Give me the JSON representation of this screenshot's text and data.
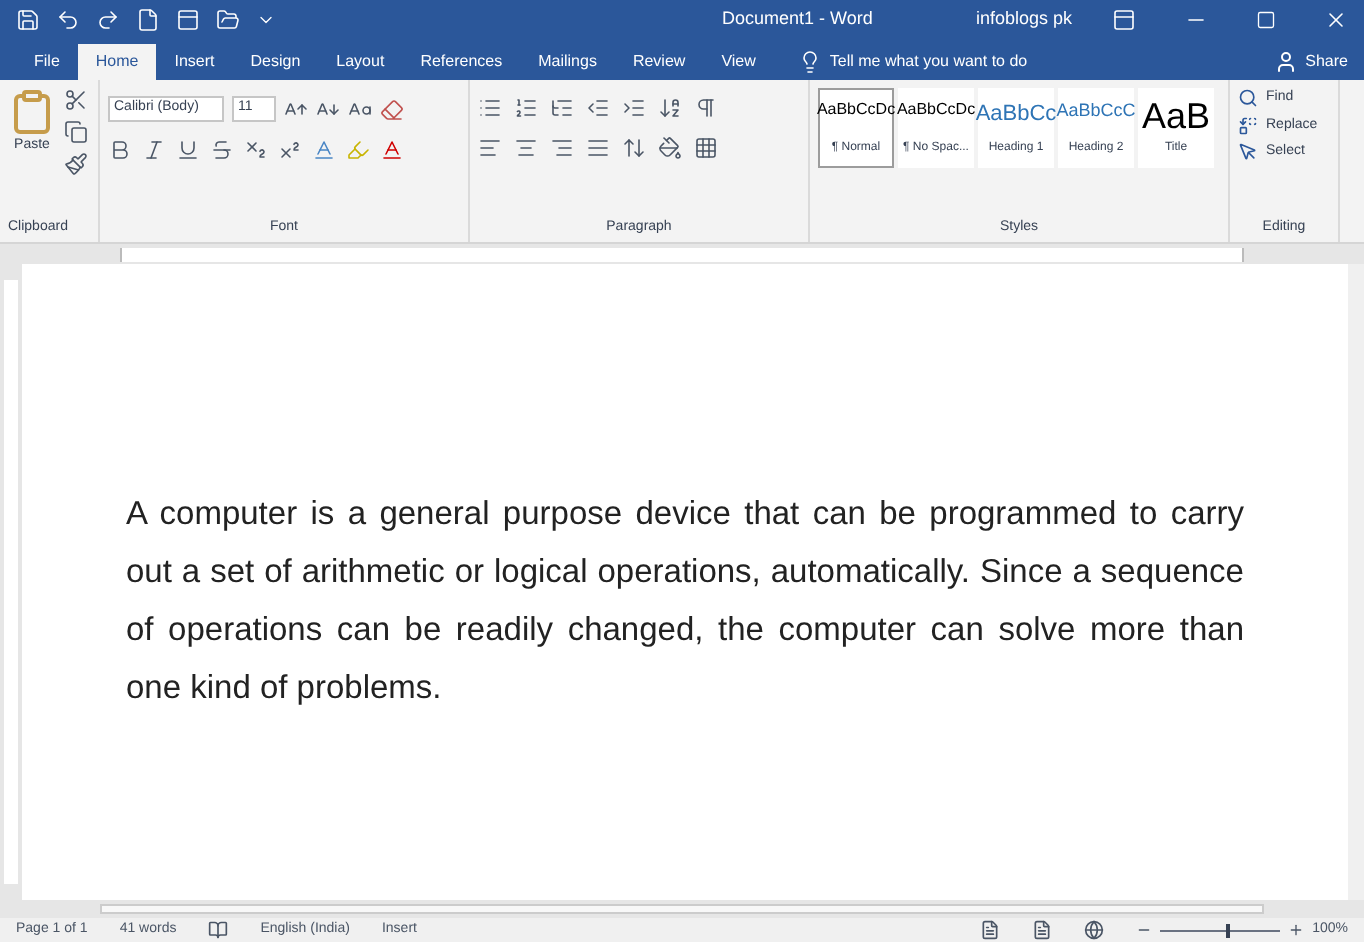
{
  "window": {
    "title": "Document1 - Word",
    "user": "infoblogs pk"
  },
  "tabs": [
    {
      "label": "File",
      "selected": false
    },
    {
      "label": "Home",
      "selected": true
    },
    {
      "label": "Insert",
      "selected": false
    },
    {
      "label": "Design",
      "selected": false
    },
    {
      "label": "Layout",
      "selected": false
    },
    {
      "label": "References",
      "selected": false
    },
    {
      "label": "Mailings",
      "selected": false
    },
    {
      "label": "Review",
      "selected": false
    },
    {
      "label": "View",
      "selected": false
    }
  ],
  "tell_me": {
    "placeholder": "Tell me what you want to do"
  },
  "share": "Share",
  "ribbon": {
    "paste": "Paste",
    "font_name": "Calibri (Body)",
    "font_size": "11",
    "groups": [
      "Clipboard",
      "Font",
      "Paragraph",
      "Styles",
      "Editing"
    ],
    "styles": [
      {
        "kind": "normal",
        "preview": "AaBbCcDc",
        "name": "¶ Normal",
        "selected": true
      },
      {
        "kind": "normal",
        "preview": "AaBbCcDc",
        "name": "¶ No Spac...",
        "selected": false
      },
      {
        "kind": "heading1",
        "preview": "AaBbCc",
        "name": "Heading 1",
        "selected": false
      },
      {
        "kind": "heading2",
        "preview": "AaBbCcC",
        "name": "Heading 2",
        "selected": false
      },
      {
        "kind": "title",
        "preview": "AaB",
        "name": "Title",
        "selected": false
      }
    ],
    "editing": [
      "Find",
      "Replace",
      "Select"
    ]
  },
  "document": {
    "paragraph": "A computer is a general purpose device that can be programmed to carry out a set of arithmetic or logical operations, automatically. Since a sequence of operations can be readily changed, the computer can solve more than one kind of problems."
  },
  "status_bar": {
    "page": "Page 1 of 1",
    "words": "41 words",
    "language": "English (India)",
    "mode": "Insert",
    "zoom": {
      "level": 0.55,
      "reading": "100%"
    }
  }
}
